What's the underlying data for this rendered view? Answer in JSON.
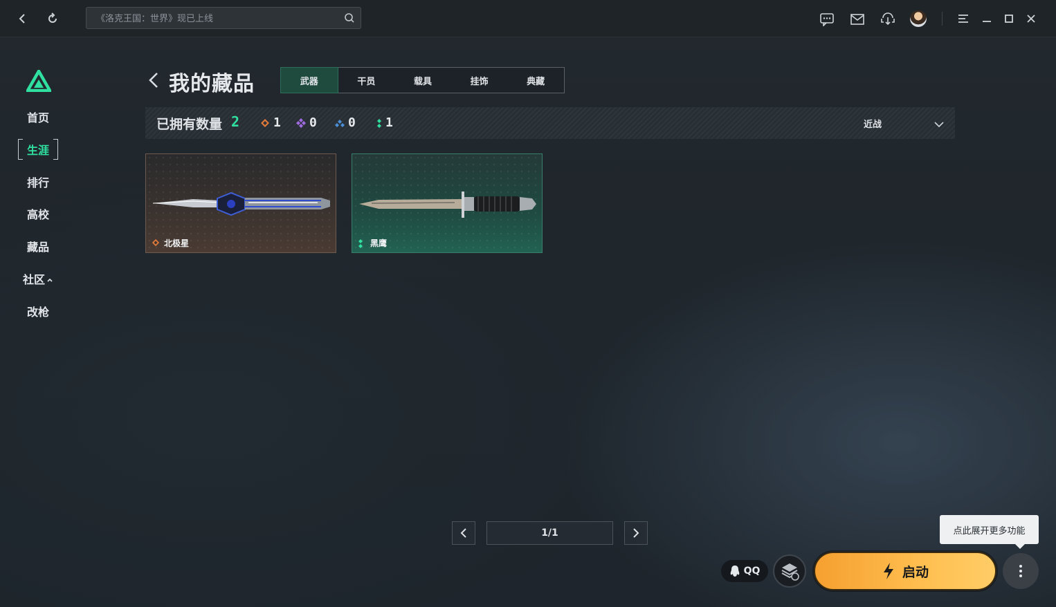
{
  "topbar": {
    "search_placeholder": "《洛克王国：世界》现已上线",
    "icons": [
      "back-icon",
      "refresh-icon",
      "search-icon",
      "chat-icon",
      "mail-icon",
      "download-icon",
      "avatar",
      "menu-icon",
      "minimize-icon",
      "maximize-icon",
      "close-icon"
    ]
  },
  "nav": {
    "items": [
      {
        "label": "首页"
      },
      {
        "label": "生涯"
      },
      {
        "label": "排行"
      },
      {
        "label": "高校"
      },
      {
        "label": "藏品"
      },
      {
        "label": "社区"
      },
      {
        "label": "改枪"
      }
    ],
    "active_index": 1
  },
  "header": {
    "title": "我的藏品",
    "tabs": [
      {
        "label": "武器"
      },
      {
        "label": "干员"
      },
      {
        "label": "载具"
      },
      {
        "label": "挂饰"
      },
      {
        "label": "典藏"
      }
    ],
    "active_tab": 0
  },
  "stats": {
    "owned_label": "已拥有数量",
    "owned_count": "2",
    "rarities": [
      {
        "color": "#e07a3a",
        "count": "1"
      },
      {
        "color": "#a06ae0",
        "count": "0"
      },
      {
        "color": "#4a8ed8",
        "count": "0"
      },
      {
        "color": "#2fe0a0",
        "count": "1"
      }
    ],
    "filter_value": "近战"
  },
  "items": [
    {
      "name": "北极星",
      "rarity_color": "#e07a3a"
    },
    {
      "name": "黑鹰",
      "rarity_color": "#2fe0a0"
    }
  ],
  "pagination": {
    "label": "1/1"
  },
  "bottom": {
    "tooltip": "点此展开更多功能",
    "qq_label": "QQ",
    "launch_label": "启动"
  },
  "colors": {
    "accent": "#2fe0a0",
    "launch": "#ffb13d"
  }
}
